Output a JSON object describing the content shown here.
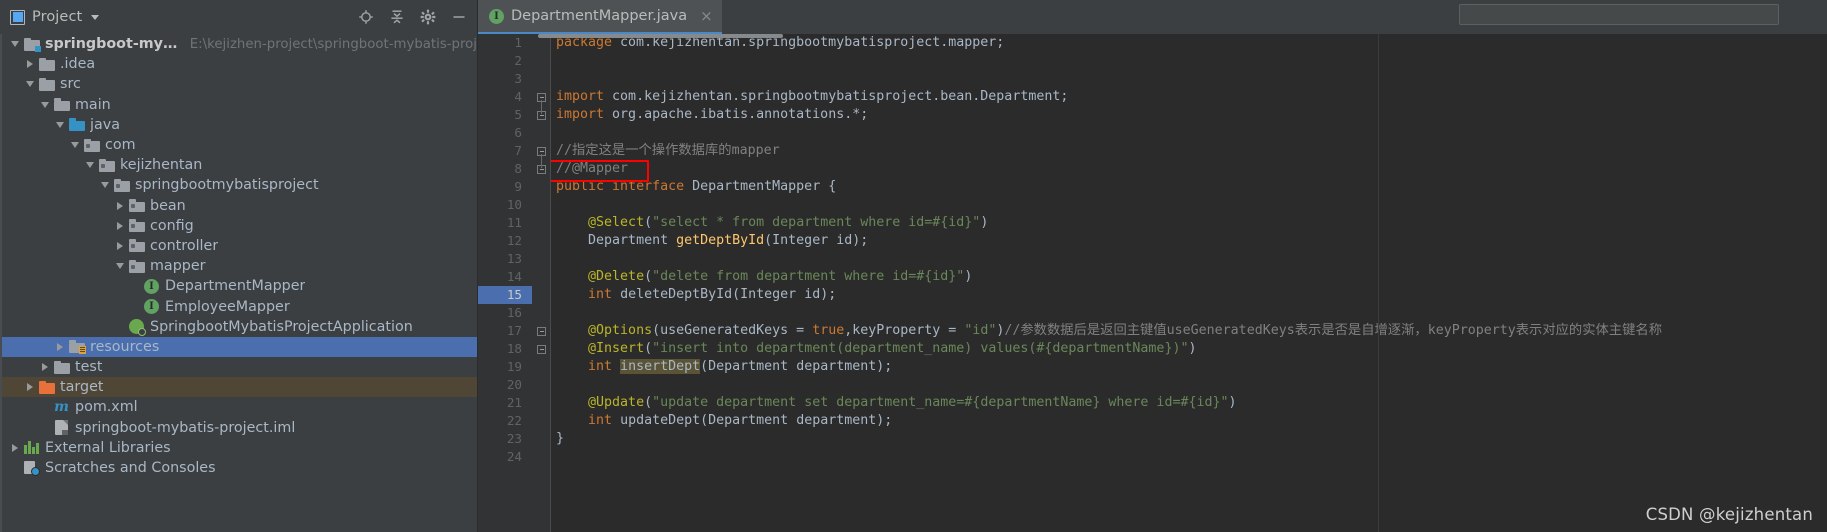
{
  "window": {
    "panel_title": "Project",
    "header_icons": [
      {
        "name": "locate-icon",
        "title": "Select Opened File"
      },
      {
        "name": "collapse-all-icon",
        "title": "Collapse All"
      },
      {
        "name": "gear-icon",
        "title": "Settings"
      },
      {
        "name": "minimize-icon",
        "title": "Hide"
      }
    ]
  },
  "tabs": [
    {
      "label": "DepartmentMapper.java",
      "badge": "I",
      "close": "×",
      "active": true
    }
  ],
  "tree": [
    {
      "depth": 0,
      "arrow": "down",
      "icon": "folder-module",
      "label": "springboot-mybatis-project",
      "path": "E:\\kejizhen-project\\springboot-mybatis-proj",
      "state": "root"
    },
    {
      "depth": 1,
      "arrow": "right",
      "icon": "folder-gray",
      "label": ".idea",
      "path": "",
      "state": "normal"
    },
    {
      "depth": 1,
      "arrow": "down",
      "icon": "folder-gray",
      "label": "src",
      "path": "",
      "state": "normal"
    },
    {
      "depth": 2,
      "arrow": "down",
      "icon": "folder-gray",
      "label": "main",
      "path": "",
      "state": "normal"
    },
    {
      "depth": 3,
      "arrow": "down",
      "icon": "folder-source",
      "label": "java",
      "path": "",
      "state": "normal"
    },
    {
      "depth": 4,
      "arrow": "down",
      "icon": "folder-package",
      "label": "com",
      "path": "",
      "state": "normal"
    },
    {
      "depth": 5,
      "arrow": "down",
      "icon": "folder-package",
      "label": "kejizhentan",
      "path": "",
      "state": "normal"
    },
    {
      "depth": 6,
      "arrow": "down",
      "icon": "folder-package",
      "label": "springbootmybatisproject",
      "path": "",
      "state": "normal"
    },
    {
      "depth": 7,
      "arrow": "right",
      "icon": "folder-package",
      "label": "bean",
      "path": "",
      "state": "normal"
    },
    {
      "depth": 7,
      "arrow": "right",
      "icon": "folder-package",
      "label": "config",
      "path": "",
      "state": "normal"
    },
    {
      "depth": 7,
      "arrow": "right",
      "icon": "folder-package",
      "label": "controller",
      "path": "",
      "state": "normal"
    },
    {
      "depth": 7,
      "arrow": "down",
      "icon": "folder-package",
      "label": "mapper",
      "path": "",
      "state": "normal"
    },
    {
      "depth": 8,
      "arrow": "none",
      "icon": "interface-icon",
      "label": "DepartmentMapper",
      "path": "",
      "state": "normal"
    },
    {
      "depth": 8,
      "arrow": "none",
      "icon": "interface-icon",
      "label": "EmployeeMapper",
      "path": "",
      "state": "normal"
    },
    {
      "depth": 7,
      "arrow": "none",
      "icon": "spring-icon",
      "label": "SpringbootMybatisProjectApplication",
      "path": "",
      "state": "normal"
    },
    {
      "depth": 3,
      "arrow": "right",
      "icon": "folder-resources",
      "label": "resources",
      "path": "",
      "state": "selected"
    },
    {
      "depth": 2,
      "arrow": "right",
      "icon": "folder-gray",
      "label": "test",
      "path": "",
      "state": "normal"
    },
    {
      "depth": 1,
      "arrow": "right",
      "icon": "folder-excluded",
      "label": "target",
      "path": "",
      "state": "excluded"
    },
    {
      "depth": 2,
      "arrow": "none",
      "icon": "maven-icon",
      "label": "pom.xml",
      "path": "",
      "state": "normal"
    },
    {
      "depth": 2,
      "arrow": "none",
      "icon": "iml-icon",
      "label": "springboot-mybatis-project.iml",
      "path": "",
      "state": "normal"
    },
    {
      "depth": 0,
      "arrow": "right",
      "icon": "library-icon",
      "label": "External Libraries",
      "path": "",
      "state": "normal"
    },
    {
      "depth": 0,
      "arrow": "none",
      "icon": "scratches-icon",
      "label": "Scratches and Consoles",
      "path": "",
      "state": "normal"
    }
  ],
  "editor": {
    "first_line": 1,
    "highlighted_line": 15,
    "lines": [
      {
        "n": 1,
        "fold": "none",
        "tokens": [
          {
            "t": "package ",
            "c": "kw"
          },
          {
            "t": "com.kejizhentan.springbootmybatisproject.mapper;",
            "c": "plain"
          }
        ]
      },
      {
        "n": 2,
        "fold": "none",
        "tokens": []
      },
      {
        "n": 3,
        "fold": "none",
        "tokens": []
      },
      {
        "n": 4,
        "fold": "start",
        "tokens": [
          {
            "t": "import ",
            "c": "kw"
          },
          {
            "t": "com.kejizhentan.springbootmybatisproject.bean.Department;",
            "c": "plain"
          }
        ]
      },
      {
        "n": 5,
        "fold": "end",
        "tokens": [
          {
            "t": "import ",
            "c": "kw"
          },
          {
            "t": "org.apache.ibatis.annotations.*;",
            "c": "plain"
          }
        ]
      },
      {
        "n": 6,
        "fold": "none",
        "tokens": []
      },
      {
        "n": 7,
        "fold": "start",
        "tokens": [
          {
            "t": "//指定这是一个操作数据库的mapper",
            "c": "cmt"
          }
        ]
      },
      {
        "n": 8,
        "fold": "end",
        "tokens": [
          {
            "t": "//@Mapper",
            "c": "cmt"
          }
        ]
      },
      {
        "n": 9,
        "fold": "none",
        "tokens": [
          {
            "t": "public ",
            "c": "kw"
          },
          {
            "t": "interface ",
            "c": "kw"
          },
          {
            "t": "DepartmentMapper ",
            "c": "plain"
          },
          {
            "t": "{",
            "c": "plain"
          }
        ]
      },
      {
        "n": 10,
        "fold": "none",
        "tokens": []
      },
      {
        "n": 11,
        "fold": "none",
        "tokens": [
          {
            "t": "    ",
            "c": "plain"
          },
          {
            "t": "@Select",
            "c": "anno"
          },
          {
            "t": "(",
            "c": "plain"
          },
          {
            "t": "\"select * from department where id=#{id}\"",
            "c": "str"
          },
          {
            "t": ")",
            "c": "plain"
          }
        ]
      },
      {
        "n": 12,
        "fold": "none",
        "tokens": [
          {
            "t": "    ",
            "c": "plain"
          },
          {
            "t": "Department ",
            "c": "plain"
          },
          {
            "t": "getDeptById",
            "c": "meth"
          },
          {
            "t": "(Integer id);",
            "c": "plain"
          }
        ]
      },
      {
        "n": 13,
        "fold": "none",
        "tokens": []
      },
      {
        "n": 14,
        "fold": "none",
        "tokens": [
          {
            "t": "    ",
            "c": "plain"
          },
          {
            "t": "@Delete",
            "c": "anno"
          },
          {
            "t": "(",
            "c": "plain"
          },
          {
            "t": "\"delete from department where id=#{id}\"",
            "c": "str"
          },
          {
            "t": ")",
            "c": "plain"
          }
        ]
      },
      {
        "n": 15,
        "fold": "none",
        "tokens": [
          {
            "t": "    ",
            "c": "plain"
          },
          {
            "t": "int ",
            "c": "kw"
          },
          {
            "t": "deleteDeptById",
            "c": "plain"
          },
          {
            "t": "(Integer id);",
            "c": "plain"
          }
        ]
      },
      {
        "n": 16,
        "fold": "none",
        "tokens": []
      },
      {
        "n": 17,
        "fold": "start",
        "tokens": [
          {
            "t": "    ",
            "c": "plain"
          },
          {
            "t": "@Options",
            "c": "anno"
          },
          {
            "t": "(useGeneratedKeys = ",
            "c": "plain"
          },
          {
            "t": "true",
            "c": "kw"
          },
          {
            "t": ",keyProperty = ",
            "c": "plain"
          },
          {
            "t": "\"id\"",
            "c": "str"
          },
          {
            "t": ")",
            "c": "plain"
          },
          {
            "t": "//参数数据后是返回主键值useGeneratedKeys表示是否是自增逐渐，keyProperty表示对应的实体主键名称",
            "c": "cmt"
          }
        ]
      },
      {
        "n": 18,
        "fold": "end",
        "tokens": [
          {
            "t": "    ",
            "c": "plain"
          },
          {
            "t": "@Insert",
            "c": "anno"
          },
          {
            "t": "(",
            "c": "plain"
          },
          {
            "t": "\"insert into department(department_name) values(#{departmentName})\"",
            "c": "str"
          },
          {
            "t": ")",
            "c": "plain"
          }
        ]
      },
      {
        "n": 19,
        "fold": "none",
        "tokens": [
          {
            "t": "    ",
            "c": "plain"
          },
          {
            "t": "int ",
            "c": "kw"
          },
          {
            "t": "insertDept",
            "c": "hlident"
          },
          {
            "t": "(Department department);",
            "c": "plain"
          }
        ]
      },
      {
        "n": 20,
        "fold": "none",
        "tokens": []
      },
      {
        "n": 21,
        "fold": "none",
        "tokens": [
          {
            "t": "    ",
            "c": "plain"
          },
          {
            "t": "@Update",
            "c": "anno"
          },
          {
            "t": "(",
            "c": "plain"
          },
          {
            "t": "\"update department set department_name=#{departmentName} where id=#{id}\"",
            "c": "str"
          },
          {
            "t": ")",
            "c": "plain"
          }
        ]
      },
      {
        "n": 22,
        "fold": "none",
        "tokens": [
          {
            "t": "    ",
            "c": "plain"
          },
          {
            "t": "int ",
            "c": "kw"
          },
          {
            "t": "updateDept",
            "c": "plain"
          },
          {
            "t": "(Department department);",
            "c": "plain"
          }
        ]
      },
      {
        "n": 23,
        "fold": "none",
        "tokens": [
          {
            "t": "}",
            "c": "plain"
          }
        ]
      },
      {
        "n": 24,
        "fold": "none",
        "tokens": []
      }
    ]
  },
  "annotation": {
    "red_box_target_line": 8,
    "red_box_text": "//@Mapper",
    "color": "#ff0000"
  },
  "watermark": {
    "text": "CSDN @kejizhentan"
  },
  "colors": {
    "panel_bg": "#3c3f41",
    "editor_bg": "#2b2b2b",
    "gutter_bg": "#313335",
    "selection_blue": "#4b6eaf",
    "excluded_brown": "#4f4636",
    "tab_active_bg": "#4e5254",
    "tab_underline": "#4a88c7",
    "keyword": "#cc7832",
    "annotation": "#bbb529",
    "string": "#6a8759",
    "comment": "#808080",
    "method": "#ffc66d",
    "text": "#a9b7c6"
  }
}
